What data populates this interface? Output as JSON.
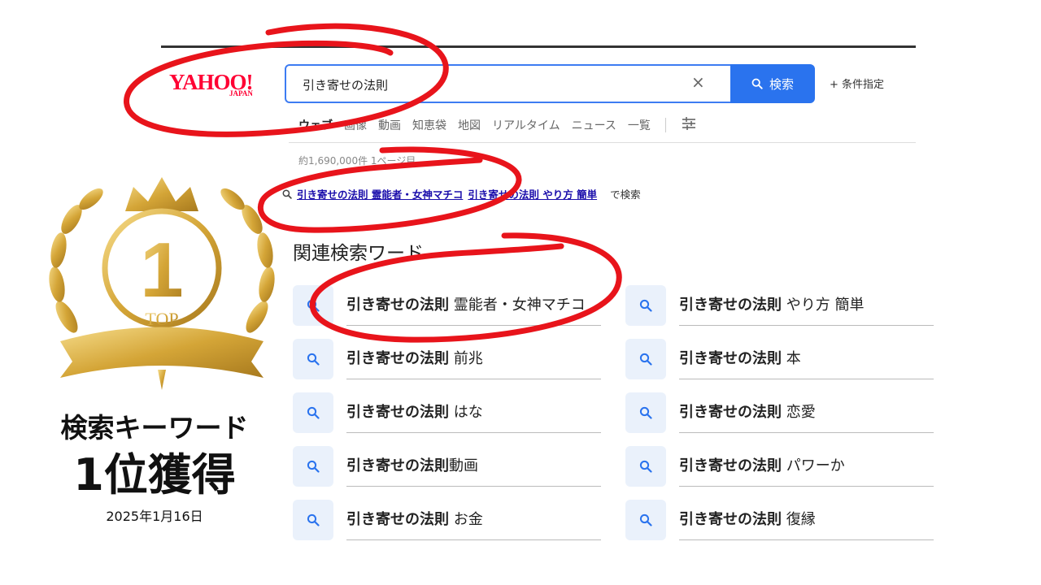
{
  "logo": {
    "main": "YAHOO!",
    "sub": "JAPAN"
  },
  "search": {
    "value": "引き寄せの法則",
    "placeholder": "",
    "clear_glyph": "×",
    "button_label": "検索",
    "advanced_label": "+ 条件指定"
  },
  "tabs": [
    "ウェブ",
    "画像",
    "動画",
    "知恵袋",
    "地図",
    "リアルタイム",
    "ニュース",
    "一覧"
  ],
  "result_count": "約1,690,000件 1ページ目",
  "suggest": {
    "link1": "引き寄せの法則 霊能者・女神マチコ",
    "link2": "引き寄せの法則 やり方 簡単",
    "suffix": "で検索"
  },
  "related": {
    "title": "関連検索ワード",
    "items": [
      {
        "bold": "引き寄せの法則",
        "rest": " 霊能者・女神マチコ"
      },
      {
        "bold": "引き寄せの法則",
        "rest": " やり方 簡単"
      },
      {
        "bold": "引き寄せの法則",
        "rest": " 前兆"
      },
      {
        "bold": "引き寄せの法則",
        "rest": " 本"
      },
      {
        "bold": "引き寄せの法則",
        "rest": " はな"
      },
      {
        "bold": "引き寄せの法則",
        "rest": " 恋愛"
      },
      {
        "bold": "引き寄せの法則",
        "rest": "動画"
      },
      {
        "bold": "引き寄せの法則",
        "rest": " パワーか"
      },
      {
        "bold": "引き寄せの法則",
        "rest": " お金"
      },
      {
        "bold": "引き寄せの法則",
        "rest": " 復縁"
      }
    ]
  },
  "award": {
    "number": "1",
    "label": "TOP",
    "title": "検索キーワード",
    "rank": "1位獲得",
    "date": "2025年1月16日"
  },
  "colors": {
    "accent": "#2a73ee",
    "logo": "#ff0033",
    "gold": "#d4a537",
    "highlight": "#e8141b"
  },
  "icons": {
    "search": "search-icon",
    "clear": "clear-icon",
    "tune": "filter-icon",
    "crown": "crown-icon",
    "laurel": "laurel-icon"
  }
}
